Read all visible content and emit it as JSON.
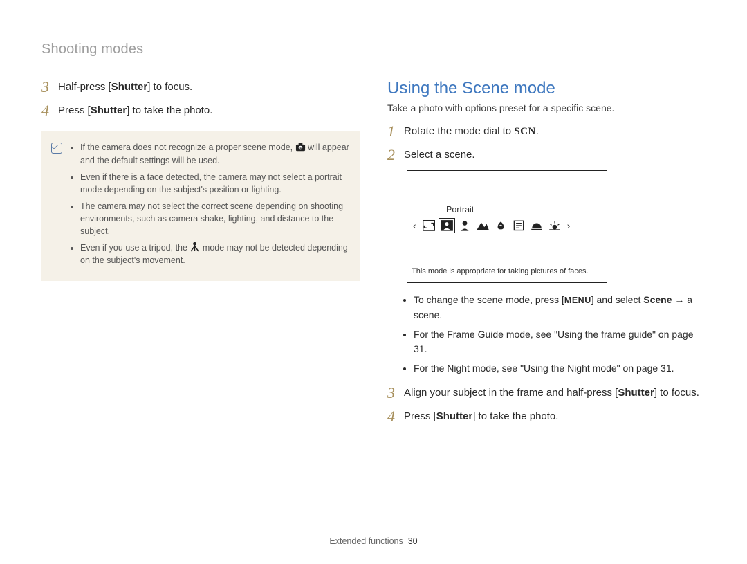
{
  "breadcrumb": "Shooting modes",
  "left": {
    "steps": [
      {
        "num": "3",
        "pre": "Half-press [",
        "bold": "Shutter",
        "post": "] to focus."
      },
      {
        "num": "4",
        "pre": "Press [",
        "bold": "Shutter",
        "post": "] to take the photo."
      }
    ],
    "notes": [
      {
        "pre": "If the camera does not recognize a proper scene mode, ",
        "post": " will appear and the default settings will be used.",
        "icon": "smart-auto-icon"
      },
      {
        "text": "Even if there is a face detected, the camera may not select a portrait mode depending on the subject's position or lighting."
      },
      {
        "text": "The camera may not select the correct scene depending on shooting environments, such as camera shake, lighting, and distance to the subject."
      },
      {
        "pre": "Even if you use a tripod, the ",
        "post": " mode may not be detected depending on the subject's movement.",
        "icon": "tripod-icon"
      }
    ]
  },
  "right": {
    "title": "Using the Scene mode",
    "subtitle": "Take a photo with options preset for a specific scene.",
    "step1": {
      "num": "1",
      "pre": "Rotate the mode dial to ",
      "scn": "SCN",
      "post": "."
    },
    "step2": {
      "num": "2",
      "text": "Select a scene."
    },
    "display": {
      "label": "Portrait",
      "desc": "This mode is appropriate for taking pictures of faces."
    },
    "bullets": [
      {
        "pre": "To change the scene mode, press [",
        "menu": "MENU",
        "mid": "] and select ",
        "bold": "Scene",
        "post": " → a scene."
      },
      {
        "text": "For the Frame Guide mode, see \"Using the frame guide\" on page 31."
      },
      {
        "text": "For the Night mode, see \"Using the Night mode\" on page 31."
      }
    ],
    "step3": {
      "num": "3",
      "pre": "Align your subject in the frame and half-press [",
      "bold": "Shutter",
      "post": "] to focus."
    },
    "step4": {
      "num": "4",
      "pre": "Press [",
      "bold": "Shutter",
      "post": "] to take the photo."
    }
  },
  "footer": {
    "section": "Extended functions",
    "page": "30"
  }
}
